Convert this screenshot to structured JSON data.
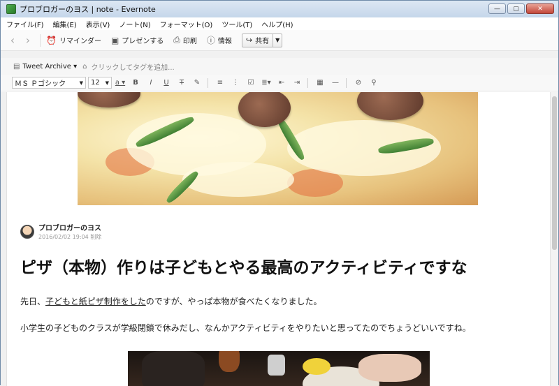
{
  "window": {
    "title": "プロブロガーのヨス | note - Evernote",
    "min_label": "—",
    "max_label": "▢",
    "close_label": "✕"
  },
  "menu": [
    "ファイル(F)",
    "編集(E)",
    "表示(V)",
    "ノート(N)",
    "フォーマット(O)",
    "ツール(T)",
    "ヘルプ(H)"
  ],
  "toolbar": {
    "back_icon": "‹",
    "forward_icon": "›",
    "reminder": "リマインダー",
    "present": "プレゼンする",
    "print": "印刷",
    "info": "情報",
    "share": "共有"
  },
  "notebar": {
    "notebook": "Tweet Archive ▾",
    "tag_placeholder": "クリックしてタグを追加..."
  },
  "format": {
    "font": "ＭＳ Ｐゴシック",
    "size": "12"
  },
  "note": {
    "author": "プロブロガーのヨス",
    "date": "2016/02/02 19:04 削除",
    "title": "ピザ（本物）作りは子どもとやる最高のアクティビティですな",
    "p1_pre": "先日、",
    "p1_link": "子どもと紙ピザ制作をした",
    "p1_post": "のですが、やっぱ本物が食べたくなりました。",
    "p2": "小学生の子どものクラスが学級閉鎖で休みだし、なんかアクティビティをやりたいと思ってたのでちょうどいいですね。"
  },
  "colors": {
    "titlebar": "#c5d6ea",
    "accent": "#6f8aa8",
    "link": "#222222"
  },
  "icons": {
    "app": "evernote-icon",
    "reminder": "alarm-clock-icon",
    "present": "presentation-icon",
    "print": "printer-icon",
    "info": "info-icon",
    "share": "share-icon",
    "notebook": "notebook-icon",
    "tag": "tag-icon"
  }
}
